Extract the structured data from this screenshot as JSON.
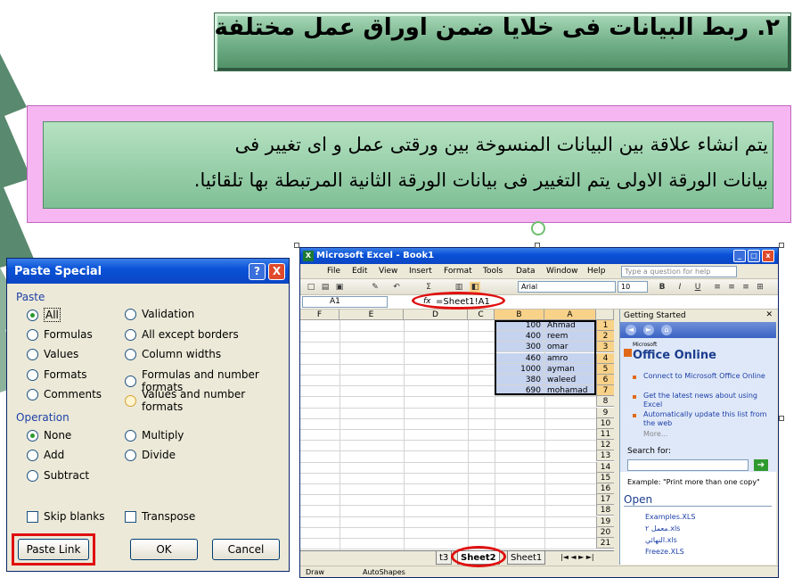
{
  "title": "٢. ربط البيانات فى خلايا ضمن اوراق عمل مختلفة",
  "description": {
    "line1": "يتم انشاء علاقة بين البيانات المنسوخة بين ورقتى عمل  و اى تغيير فى",
    "line2": "بيانات الورقة الاولى يتم التغيير فى بيانات الورقة الثانية المرتبطة بها تلقائيا."
  },
  "paste_special": {
    "title": "Paste Special",
    "help": "?",
    "close": "X",
    "paste_label": "Paste",
    "paste_options_left": [
      "All",
      "Formulas",
      "Values",
      "Formats",
      "Comments"
    ],
    "paste_options_right": [
      "Validation",
      "All except borders",
      "Column widths",
      "Formulas and number formats",
      "Values and number formats"
    ],
    "selected_paste": "All",
    "operation_label": "Operation",
    "operation_left": [
      "None",
      "Add",
      "Subtract"
    ],
    "operation_right": [
      "Multiply",
      "Divide"
    ],
    "selected_operation": "None",
    "skip_blanks": "Skip blanks",
    "transpose": "Transpose",
    "paste_link_button": "Paste Link",
    "ok_button": "OK",
    "cancel_button": "Cancel"
  },
  "excel": {
    "window_title": "Microsoft Excel - Book1",
    "menu": [
      "File",
      "Edit",
      "View",
      "Insert",
      "Format",
      "Tools",
      "Data",
      "Window",
      "Help"
    ],
    "help_placeholder": "Type a question for help",
    "font_name": "Arial",
    "font_size": "10",
    "name_box": "A1",
    "fx": "fx",
    "formula": "=Sheet1!A1",
    "columns": [
      "F",
      "E",
      "D",
      "C",
      "B",
      "A"
    ],
    "rows": [
      "1",
      "2",
      "3",
      "4",
      "5",
      "6",
      "7",
      "8",
      "9",
      "10",
      "11",
      "12",
      "13",
      "14",
      "15",
      "16",
      "17",
      "18",
      "19",
      "20",
      "21"
    ],
    "data": [
      {
        "b": "100",
        "a": "Ahmad"
      },
      {
        "b": "400",
        "a": "reem"
      },
      {
        "b": "300",
        "a": "omar"
      },
      {
        "b": "460",
        "a": "amro"
      },
      {
        "b": "1000",
        "a": "ayman"
      },
      {
        "b": "380",
        "a": "waleed"
      },
      {
        "b": "690",
        "a": "mohamad"
      }
    ],
    "tabs": [
      "t3",
      "Sheet2",
      "Sheet1"
    ],
    "active_tab": "Sheet2",
    "task_pane": {
      "header": "Getting Started",
      "office_online": "Office Online",
      "microsoft": "Microsoft",
      "links": [
        "Connect to Microsoft Office Online",
        "Get the latest news about using Excel",
        "Automatically update this list from the web"
      ],
      "more": "More...",
      "search_label": "Search for:",
      "example": "Example:  \"Print more than one copy\"",
      "open_header": "Open",
      "open_files": [
        "Examples.XLS",
        "معمل ٢.xls",
        "النهائي.xls",
        "Freeze.XLS"
      ]
    },
    "draw_bar": [
      "Draw",
      "AutoShapes"
    ]
  }
}
